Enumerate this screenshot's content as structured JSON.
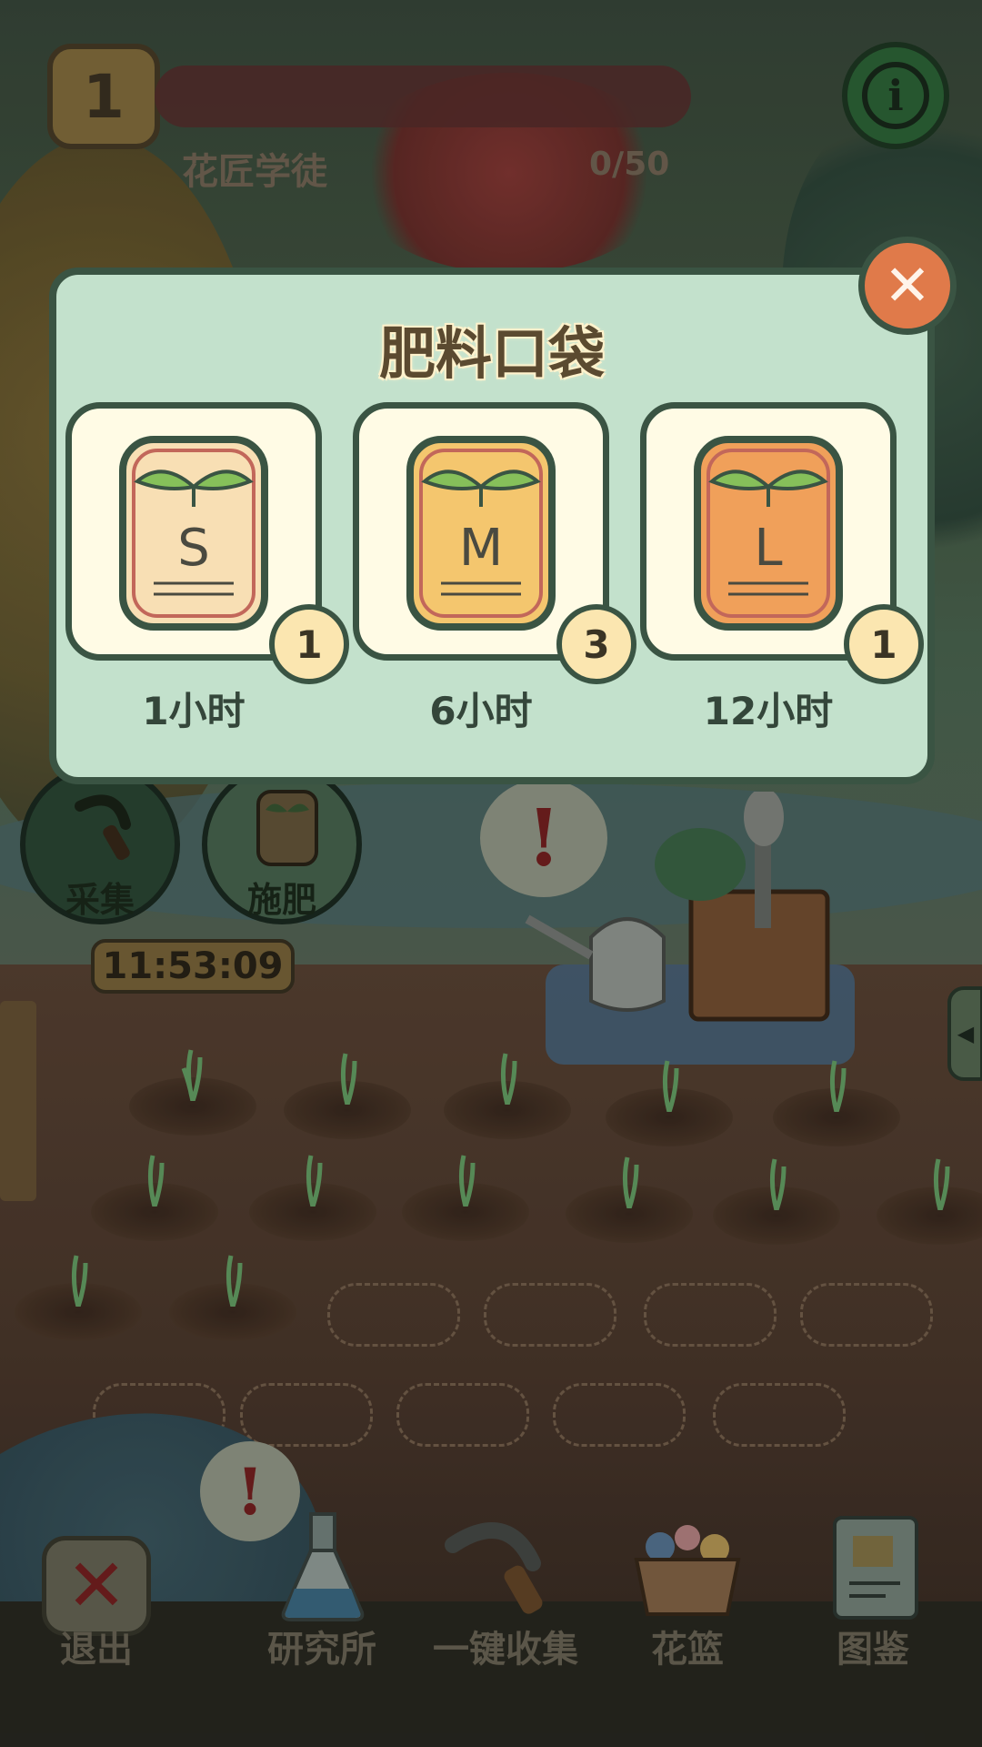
{
  "hud": {
    "level": "1",
    "rank_title": "花匠学徒",
    "xp_text": "0/50",
    "info_icon": "info-icon"
  },
  "actions": {
    "collect_label": "采集",
    "fertilize_label": "施肥",
    "timer": "11:53:09"
  },
  "popup": {
    "title": "肥料口袋",
    "close_icon": "close-icon",
    "items": [
      {
        "letter": "S",
        "count": "1",
        "duration": "1小时",
        "color": "#f8dfb4"
      },
      {
        "letter": "M",
        "count": "3",
        "duration": "6小时",
        "color": "#f4c66e"
      },
      {
        "letter": "L",
        "count": "1",
        "duration": "12小时",
        "color": "#f0a05a"
      }
    ]
  },
  "bottom_bar": {
    "exit": "退出",
    "research": "研究所",
    "collect_all": "一键收集",
    "basket": "花篮",
    "catalog": "图鉴"
  },
  "alerts": {
    "symbol": "!"
  }
}
